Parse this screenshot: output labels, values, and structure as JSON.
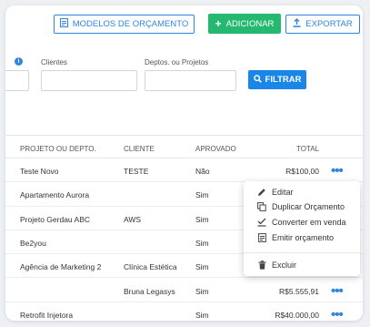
{
  "toolbar": {
    "models_label": "MODELOS DE ORÇAMENTO",
    "add_label": "ADICIONAR",
    "export_label": "EXPORTAR"
  },
  "filters": {
    "clients_label": "Clientes",
    "depts_label": "Deptos. ou Projetos",
    "filter_label": "FILTRAR"
  },
  "table": {
    "headers": [
      "PROJETO OU DEPTO.",
      "CLIENTE",
      "APROVADO",
      "TOTAL"
    ],
    "rows": [
      {
        "project": "Teste Novo",
        "client": "TESTE",
        "approved": "Não",
        "total": "R$100,00",
        "menu": true
      },
      {
        "project": "Apartamento Aurora",
        "client": "",
        "approved": "Sim",
        "total": "",
        "menu": false
      },
      {
        "project": "Projeto Gerdau ABC",
        "client": "AWS",
        "approved": "Sim",
        "total": "",
        "menu": false
      },
      {
        "project": "Be2you",
        "client": "",
        "approved": "Sim",
        "total": "",
        "menu": false
      },
      {
        "project": "Agência de Marketing 2",
        "client": "Clínica Estética",
        "approved": "Sim",
        "total": "",
        "menu": false
      },
      {
        "project": "",
        "client": "Bruna Legasys",
        "approved": "Sim",
        "total": "R$5.555,91",
        "menu": true
      },
      {
        "project": "Retrofit Injetora",
        "client": "",
        "approved": "Sim",
        "total": "R$40.000,00",
        "menu": true
      }
    ]
  },
  "context_menu": {
    "items": [
      {
        "label": "Editar",
        "icon": "pencil-icon"
      },
      {
        "label": "Duplicar Orçamento",
        "icon": "copy-icon"
      },
      {
        "label": "Converter em venda",
        "icon": "convert-icon"
      },
      {
        "label": "Emitir orçamento",
        "icon": "document-icon"
      }
    ],
    "delete_label": "Excluir",
    "delete_icon": "trash-icon"
  },
  "colors": {
    "primary": "#2f86e0",
    "success": "#25b970",
    "filter": "#1a86e8"
  }
}
